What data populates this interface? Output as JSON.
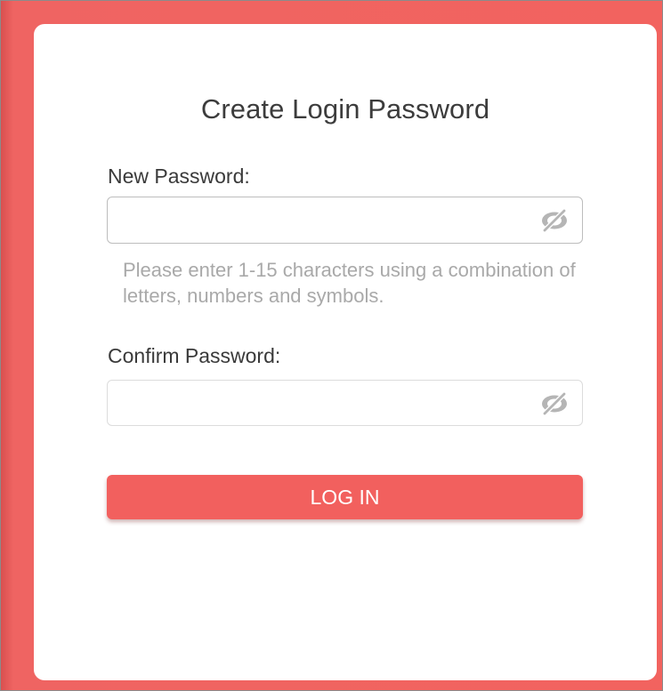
{
  "dialog": {
    "title": "Create Login Password"
  },
  "new_password": {
    "label": "New Password:",
    "value": "",
    "placeholder": "",
    "toggle_icon": "eye-slash-icon",
    "hint": "Please enter 1-15 characters using a combination of letters, numbers and symbols."
  },
  "confirm_password": {
    "label": "Confirm Password:",
    "value": "",
    "placeholder": "",
    "toggle_icon": "eye-slash-icon"
  },
  "login_button": {
    "label": "LOG IN"
  },
  "colors": {
    "accent": "#f2605e",
    "background": "#e9605d",
    "card": "#ffffff",
    "hint_text": "#a9a9a9",
    "icon": "#b5b5b5"
  }
}
